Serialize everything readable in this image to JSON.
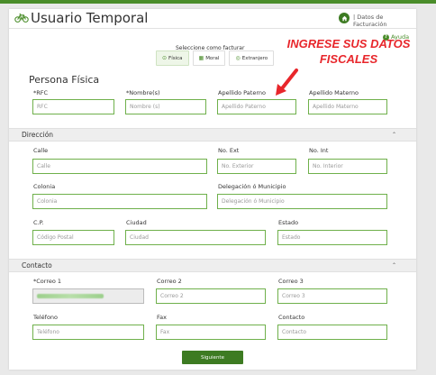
{
  "header": {
    "title": "Usuario Temporal",
    "breadcrumb": "| Datos de Facturación",
    "help_label": "Ayuda",
    "brand_icon": "bicycle-icon",
    "home_icon": "home-icon"
  },
  "billing": {
    "label": "Seleccione como facturar",
    "tabs": [
      {
        "label": "Física",
        "icon": "circle-icon"
      },
      {
        "label": "Moral",
        "icon": "building-icon"
      },
      {
        "label": "Extranjero",
        "icon": "globe-icon"
      }
    ],
    "selected": "Física"
  },
  "annotation": {
    "line1": "INGRESE SUS DATOS",
    "line2": "FISCALES",
    "color": "#e8262b"
  },
  "persona": {
    "title": "Persona Física",
    "fields": [
      {
        "label": "*RFC",
        "placeholder": "RFC"
      },
      {
        "label": "*Nombre(s)",
        "placeholder": "Nombre (s)"
      },
      {
        "label": "Apellido Paterno",
        "placeholder": "Apellido Paterno"
      },
      {
        "label": "Apellido Materno",
        "placeholder": "Apellido Materno"
      }
    ]
  },
  "direccion": {
    "title": "Dirección",
    "collapse_icon": "chevron-up-icon",
    "fields": [
      {
        "label": "Calle",
        "placeholder": "Calle"
      },
      {
        "label": "No. Ext",
        "placeholder": "No. Exterior"
      },
      {
        "label": "No. Int",
        "placeholder": "No. Interior"
      },
      {
        "label": "Colonia",
        "placeholder": "Colonia"
      },
      {
        "label": "Delegación ó Municipio",
        "placeholder": "Delegación ó Municipio"
      },
      {
        "label": "C.P.",
        "placeholder": "Código Postal"
      },
      {
        "label": "Ciudad",
        "placeholder": "Ciudad"
      },
      {
        "label": "Estado",
        "placeholder": "Estado"
      }
    ]
  },
  "contacto": {
    "title": "Contacto",
    "collapse_icon": "chevron-up-icon",
    "fields": [
      {
        "label": "*Correo 1",
        "placeholder": ""
      },
      {
        "label": "Correo 2",
        "placeholder": "Correo 2"
      },
      {
        "label": "Correo 3",
        "placeholder": "Correo 3"
      },
      {
        "label": "Teléfono",
        "placeholder": "Teléfono"
      },
      {
        "label": "Fax",
        "placeholder": "Fax"
      },
      {
        "label": "Contacto",
        "placeholder": "Contacto"
      }
    ]
  },
  "actions": {
    "submit_label": "Siguiente"
  },
  "colors": {
    "accent": "#4a8d2a",
    "input_border": "#6fb04b",
    "button": "#3d7b22"
  }
}
